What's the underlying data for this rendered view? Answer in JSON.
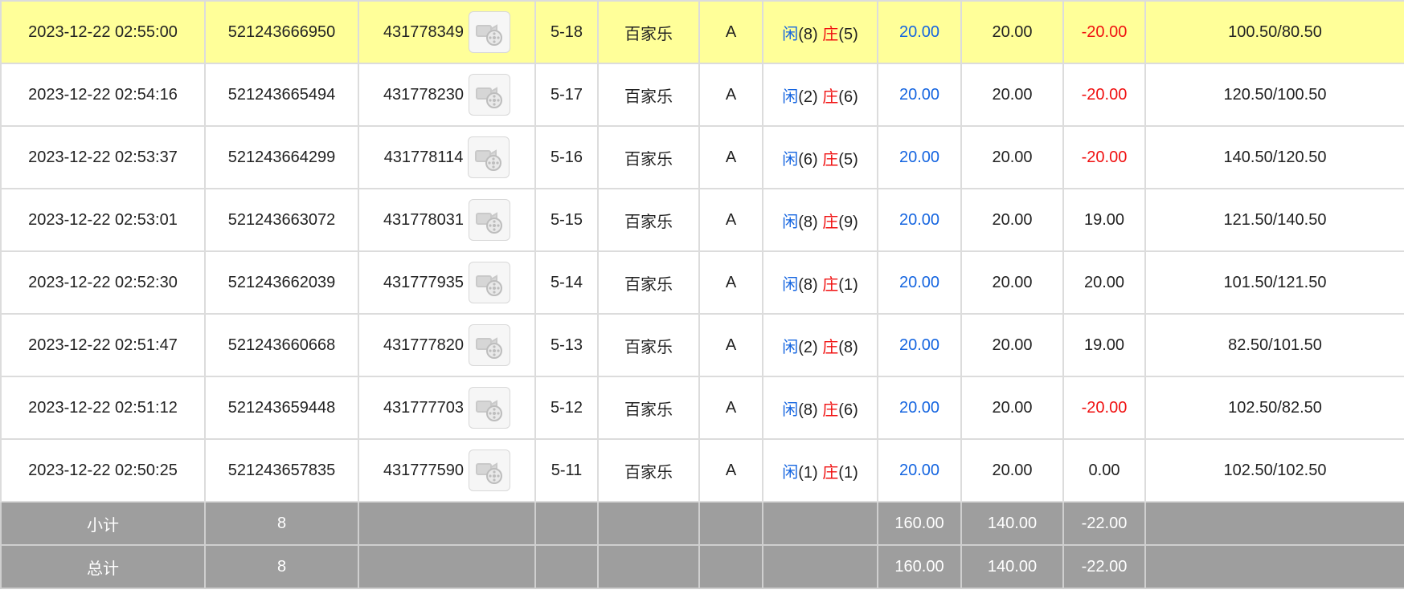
{
  "rows": [
    {
      "time": "2023-12-22 02:55:00",
      "order_no": "521243666950",
      "round_id": "431778349",
      "shoe": "5-18",
      "game": "百家乐",
      "table": "A",
      "player_label": "闲",
      "player_point": "(8)",
      "banker_label": "庄",
      "banker_point": "(5)",
      "bet": "20.00",
      "valid_bet": "20.00",
      "win_loss": "-20.00",
      "win_loss_negative": true,
      "balance": "100.50/80.50",
      "highlight": true
    },
    {
      "time": "2023-12-22 02:54:16",
      "order_no": "521243665494",
      "round_id": "431778230",
      "shoe": "5-17",
      "game": "百家乐",
      "table": "A",
      "player_label": "闲",
      "player_point": "(2)",
      "banker_label": "庄",
      "banker_point": "(6)",
      "bet": "20.00",
      "valid_bet": "20.00",
      "win_loss": "-20.00",
      "win_loss_negative": true,
      "balance": "120.50/100.50",
      "highlight": false
    },
    {
      "time": "2023-12-22 02:53:37",
      "order_no": "521243664299",
      "round_id": "431778114",
      "shoe": "5-16",
      "game": "百家乐",
      "table": "A",
      "player_label": "闲",
      "player_point": "(6)",
      "banker_label": "庄",
      "banker_point": "(5)",
      "bet": "20.00",
      "valid_bet": "20.00",
      "win_loss": "-20.00",
      "win_loss_negative": true,
      "balance": "140.50/120.50",
      "highlight": false
    },
    {
      "time": "2023-12-22 02:53:01",
      "order_no": "521243663072",
      "round_id": "431778031",
      "shoe": "5-15",
      "game": "百家乐",
      "table": "A",
      "player_label": "闲",
      "player_point": "(8)",
      "banker_label": "庄",
      "banker_point": "(9)",
      "bet": "20.00",
      "valid_bet": "20.00",
      "win_loss": "19.00",
      "win_loss_negative": false,
      "balance": "121.50/140.50",
      "highlight": false
    },
    {
      "time": "2023-12-22 02:52:30",
      "order_no": "521243662039",
      "round_id": "431777935",
      "shoe": "5-14",
      "game": "百家乐",
      "table": "A",
      "player_label": "闲",
      "player_point": "(8)",
      "banker_label": "庄",
      "banker_point": "(1)",
      "bet": "20.00",
      "valid_bet": "20.00",
      "win_loss": "20.00",
      "win_loss_negative": false,
      "balance": "101.50/121.50",
      "highlight": false
    },
    {
      "time": "2023-12-22 02:51:47",
      "order_no": "521243660668",
      "round_id": "431777820",
      "shoe": "5-13",
      "game": "百家乐",
      "table": "A",
      "player_label": "闲",
      "player_point": "(2)",
      "banker_label": "庄",
      "banker_point": "(8)",
      "bet": "20.00",
      "valid_bet": "20.00",
      "win_loss": "19.00",
      "win_loss_negative": false,
      "balance": "82.50/101.50",
      "highlight": false
    },
    {
      "time": "2023-12-22 02:51:12",
      "order_no": "521243659448",
      "round_id": "431777703",
      "shoe": "5-12",
      "game": "百家乐",
      "table": "A",
      "player_label": "闲",
      "player_point": "(8)",
      "banker_label": "庄",
      "banker_point": "(6)",
      "bet": "20.00",
      "valid_bet": "20.00",
      "win_loss": "-20.00",
      "win_loss_negative": true,
      "balance": "102.50/82.50",
      "highlight": false
    },
    {
      "time": "2023-12-22 02:50:25",
      "order_no": "521243657835",
      "round_id": "431777590",
      "shoe": "5-11",
      "game": "百家乐",
      "table": "A",
      "player_label": "闲",
      "player_point": "(1)",
      "banker_label": "庄",
      "banker_point": "(1)",
      "bet": "20.00",
      "valid_bet": "20.00",
      "win_loss": "0.00",
      "win_loss_negative": false,
      "balance": "102.50/102.50",
      "highlight": false
    }
  ],
  "row_icon": "video-replay-icon",
  "subtotal": {
    "label": "小计",
    "count": "8",
    "bet": "160.00",
    "valid_bet": "140.00",
    "win_loss": "-22.00"
  },
  "total": {
    "label": "总计",
    "count": "8",
    "bet": "160.00",
    "valid_bet": "140.00",
    "win_loss": "-22.00"
  },
  "colors": {
    "highlight_row": "#ffff99",
    "summary_bg": "#9e9e9e",
    "blue": "#1565e0",
    "red": "#f01010",
    "grid": "#dcdcdc"
  }
}
